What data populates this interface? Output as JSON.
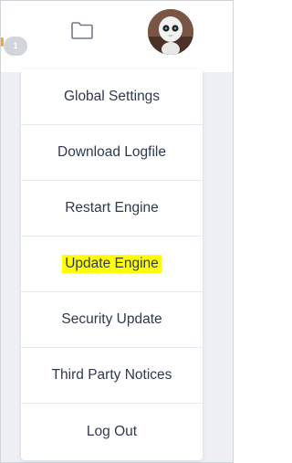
{
  "notification": {
    "count": "1"
  },
  "icons": {
    "folder": "folder-icon",
    "avatar": "robot-avatar"
  },
  "menu": {
    "items": [
      {
        "label": "Global Settings",
        "highlighted": false
      },
      {
        "label": "Download Logfile",
        "highlighted": false
      },
      {
        "label": "Restart Engine",
        "highlighted": false
      },
      {
        "label": "Update Engine",
        "highlighted": true
      },
      {
        "label": "Security Update",
        "highlighted": false
      },
      {
        "label": "Third Party Notices",
        "highlighted": false
      },
      {
        "label": "Log Out",
        "highlighted": false
      }
    ]
  },
  "colors": {
    "highlight": "#ffff00",
    "menu_text": "#2e3a4f",
    "backdrop": "#eef0f5",
    "badge": "#d2d6dc",
    "accent_orange": "#f5a623"
  }
}
